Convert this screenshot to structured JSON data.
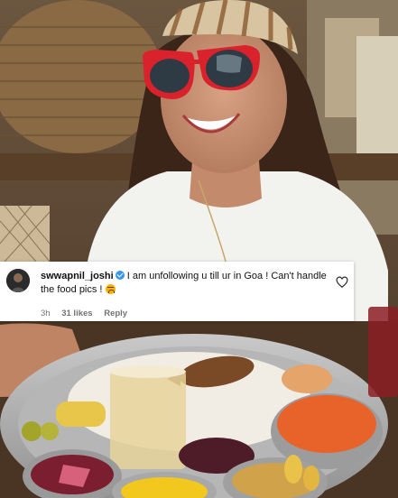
{
  "comment": {
    "username": "swwapnil_joshi",
    "text": "I am unfollowing u till ur in Goa ! Can't handle the food pics !",
    "time": "3h",
    "likes": "31 likes",
    "reply_label": "Reply"
  },
  "icons": {
    "verified": "verified-badge-icon",
    "heart": "heart-outline-icon",
    "emoji": "pleading-face-emoji"
  },
  "colors": {
    "verified_blue": "#3897f0",
    "meta_gray": "#737373"
  }
}
